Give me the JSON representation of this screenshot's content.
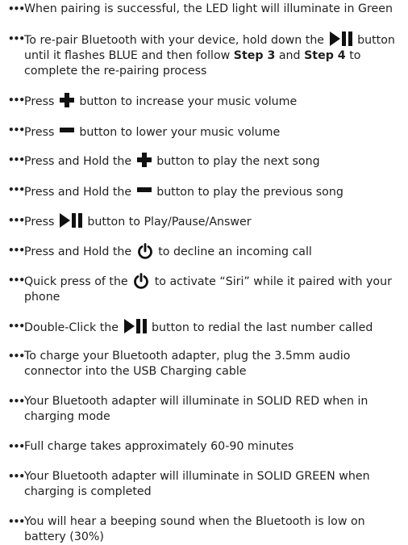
{
  "bullet": "•••",
  "items": [
    {
      "parts": [
        "When pairing is successful, the LED light will illuminate in Green"
      ]
    },
    {
      "parts": [
        "To re-pair Bluetooth with your device, hold down the",
        "button until it flashes BLUE and then follow",
        "Step 3",
        "and",
        "Step 4",
        "to complete the re-pairing process"
      ]
    },
    {
      "parts": [
        "Press",
        "button to increase your music volume"
      ]
    },
    {
      "parts": [
        "Press",
        "button to lower your music volume"
      ]
    },
    {
      "parts": [
        "Press and Hold the",
        "button to play the next song"
      ]
    },
    {
      "parts": [
        "Press and Hold the",
        "button to play the previous song"
      ]
    },
    {
      "parts": [
        "Press",
        "button to Play/Pause/Answer"
      ]
    },
    {
      "parts": [
        "Press and Hold the",
        "to decline an incoming call"
      ]
    },
    {
      "parts": [
        "Quick press of the",
        "to activate “Siri” while it paired with your phone"
      ]
    },
    {
      "parts": [
        "Double-Click the",
        "button to redial the last number called"
      ]
    },
    {
      "parts": [
        "To charge your Bluetooth adapter, plug the 3.5mm audio connector into the USB Charging cable"
      ]
    },
    {
      "parts": [
        "Your Bluetooth adapter will illuminate in SOLID RED when in charging mode"
      ]
    },
    {
      "parts": [
        "Full charge takes approximately 60-90 minutes"
      ]
    },
    {
      "parts": [
        "Your Bluetooth adapter will illuminate in SOLID GREEN when charging is completed"
      ]
    },
    {
      "parts": [
        "You will hear a beeping sound when the Bluetooth is low on battery (30%)"
      ]
    }
  ],
  "icons": {
    "plus": "plus-icon",
    "minus": "minus-icon",
    "play_pause": "play-pause-icon",
    "power": "power-icon"
  },
  "colors": {
    "text": "#1f1f1f",
    "icon": "#111111"
  }
}
